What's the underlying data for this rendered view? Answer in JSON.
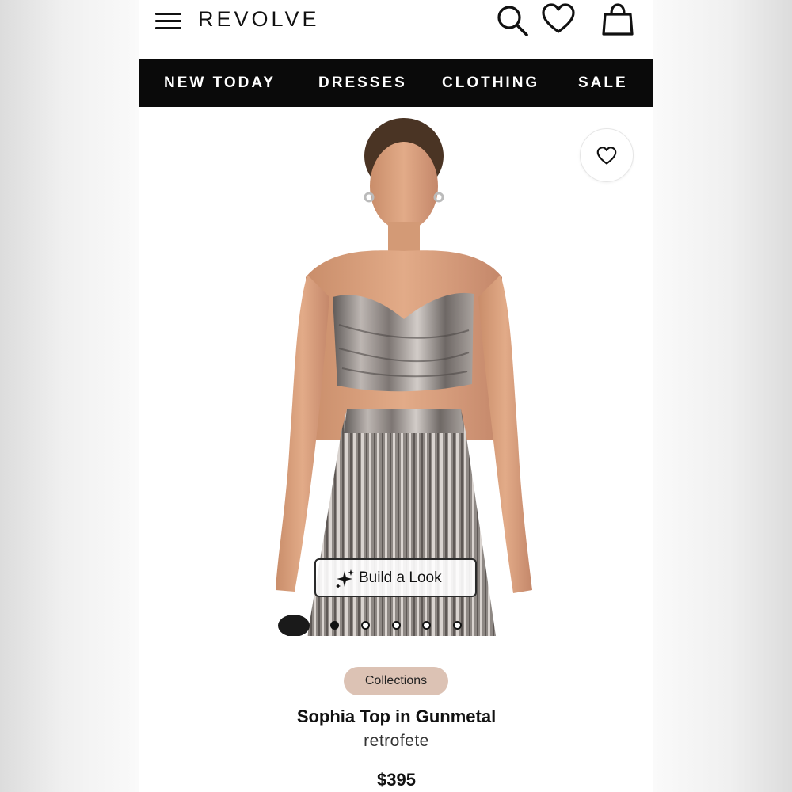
{
  "header": {
    "logo": "REVOLVE",
    "icons": [
      "menu-icon",
      "search-icon",
      "heart-icon",
      "shopping-bag-icon"
    ]
  },
  "nav": {
    "items": [
      {
        "label": "NEW TODAY"
      },
      {
        "label": "DRESSES"
      },
      {
        "label": "CLOTHING"
      },
      {
        "label": "SALE"
      }
    ]
  },
  "gallery": {
    "build_look_label": "Build a Look",
    "image_count": 5,
    "active_index": 0
  },
  "product": {
    "collection_label": "Collections",
    "name": "Sophia Top in Gunmetal",
    "brand": "retrofete",
    "price": "$395"
  },
  "colors": {
    "nav_bg": "#0a0a0a",
    "pill_bg": "#dcc2b4",
    "text": "#111111"
  }
}
